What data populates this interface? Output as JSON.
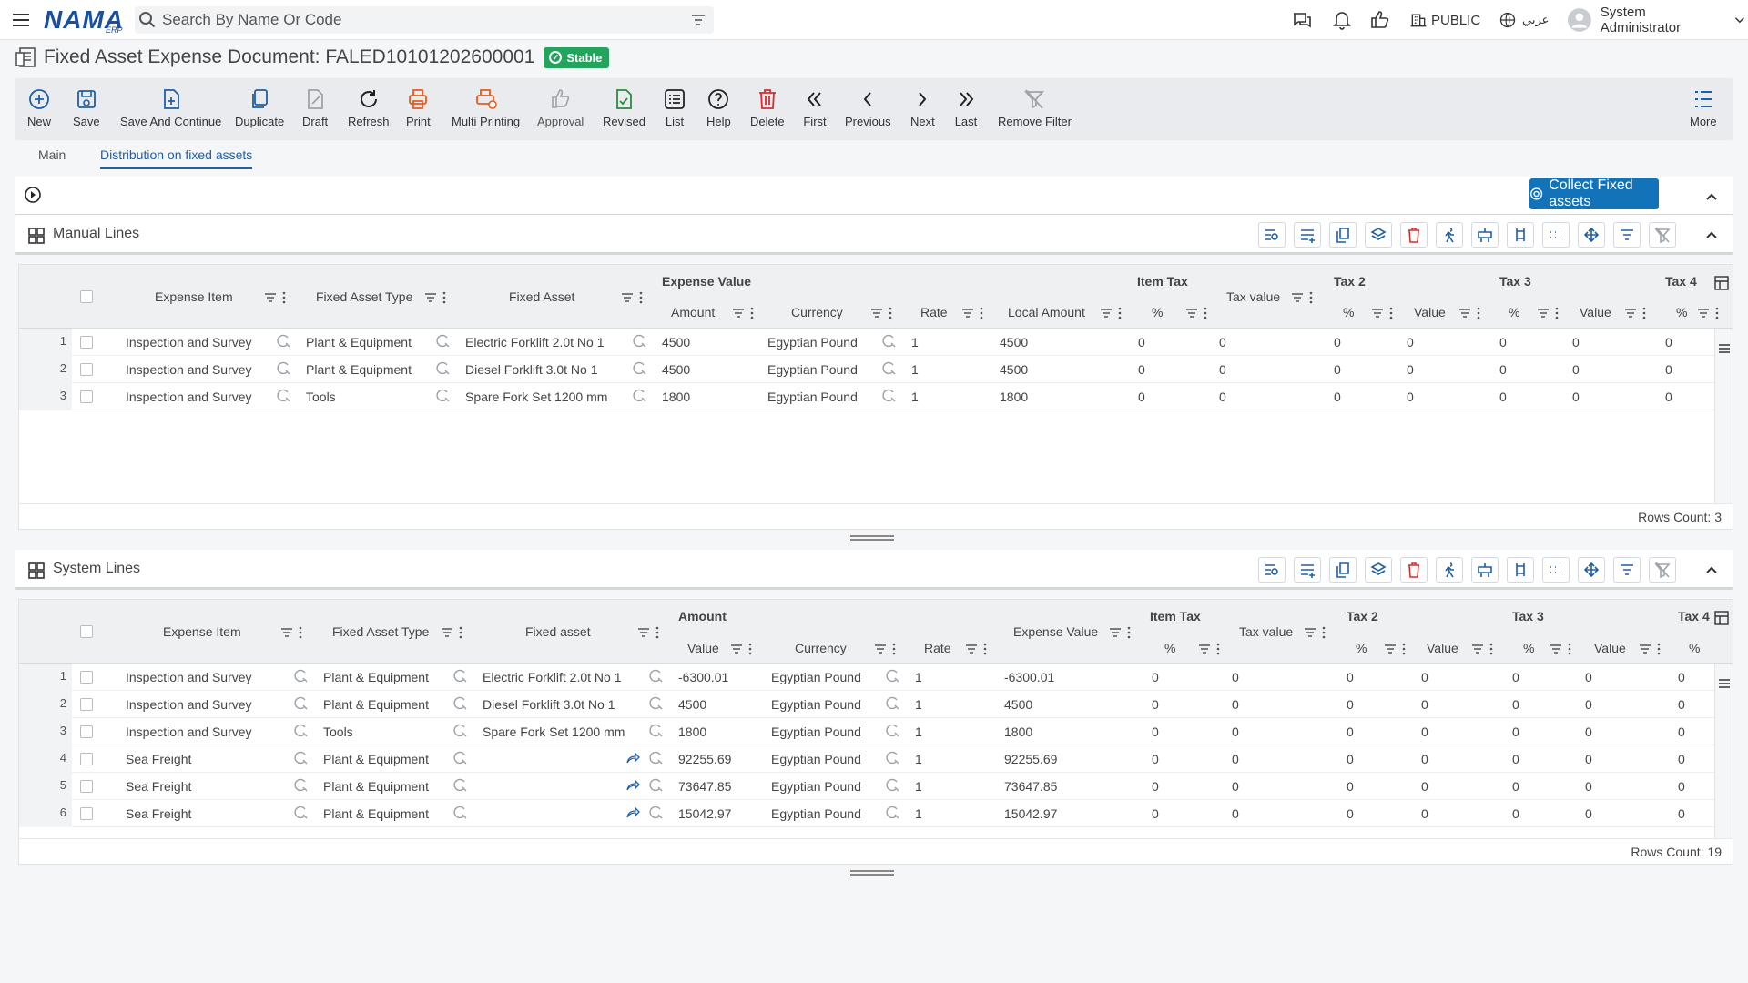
{
  "topbar": {
    "logo": "NAMA",
    "logo_sub": "ERP",
    "search_placeholder": "Search By Name Or Code",
    "company": "PUBLIC",
    "language": "عربي",
    "user": "System Administrator"
  },
  "page": {
    "title": "Fixed Asset Expense Document: FALED10101202600001",
    "status": "Stable"
  },
  "toolbar": {
    "new": "New",
    "save": "Save",
    "save_continue": "Save And Continue",
    "duplicate": "Duplicate",
    "draft": "Draft",
    "refresh": "Refresh",
    "print": "Print",
    "multi_printing": "Multi Printing",
    "approval": "Approval",
    "revised": "Revised",
    "list": "List",
    "help": "Help",
    "delete": "Delete",
    "first": "First",
    "previous": "Previous",
    "next": "Next",
    "last": "Last",
    "remove_filter": "Remove Filter",
    "more": "More"
  },
  "tabs": {
    "main": "Main",
    "distribution": "Distribution on fixed assets"
  },
  "collect_button": "Collect Fixed assets",
  "manual": {
    "title": "Manual Lines",
    "headers": {
      "expense_item": "Expense Item",
      "fixed_asset_type": "Fixed Asset Type",
      "fixed_asset": "Fixed Asset",
      "expense_value": "Expense Value",
      "amount": "Amount",
      "currency": "Currency",
      "rate": "Rate",
      "local_amount": "Local Amount",
      "item_tax": "Item Tax",
      "pct": "%",
      "tax_value": "Tax value",
      "tax2": "Tax 2",
      "value": "Value",
      "tax3": "Tax 3",
      "tax4": "Tax 4"
    },
    "rows": [
      {
        "n": "1",
        "expense_item": "Inspection and Survey",
        "type": "Plant & Equipment",
        "asset": "Electric Forklift 2.0t No 1",
        "amount": "4500",
        "currency": "Egyptian Pound",
        "rate": "1",
        "local": "4500",
        "it_pct": "0",
        "tax_value": "0",
        "t2_pct": "0",
        "t2_val": "0",
        "t3_pct": "0",
        "t3_val": "0",
        "t4_pct": "0"
      },
      {
        "n": "2",
        "expense_item": "Inspection and Survey",
        "type": "Plant & Equipment",
        "asset": "Diesel Forklift 3.0t No 1",
        "amount": "4500",
        "currency": "Egyptian Pound",
        "rate": "1",
        "local": "4500",
        "it_pct": "0",
        "tax_value": "0",
        "t2_pct": "0",
        "t2_val": "0",
        "t3_pct": "0",
        "t3_val": "0",
        "t4_pct": "0"
      },
      {
        "n": "3",
        "expense_item": "Inspection and Survey",
        "type": "Tools",
        "asset": "Spare Fork Set 1200 mm",
        "amount": "1800",
        "currency": "Egyptian Pound",
        "rate": "1",
        "local": "1800",
        "it_pct": "0",
        "tax_value": "0",
        "t2_pct": "0",
        "t2_val": "0",
        "t3_pct": "0",
        "t3_val": "0",
        "t4_pct": "0"
      }
    ],
    "rows_count": "Rows Count: 3"
  },
  "system": {
    "title": "System Lines",
    "headers": {
      "expense_item": "Expense Item",
      "fixed_asset_type": "Fixed Asset Type",
      "fixed_asset": "Fixed asset",
      "amount": "Amount",
      "value": "Value",
      "currency": "Currency",
      "rate": "Rate",
      "expense_value": "Expense Value",
      "item_tax": "Item Tax",
      "pct": "%",
      "tax_value": "Tax value",
      "tax2": "Tax 2",
      "tax3": "Tax 3",
      "tax4": "Tax 4"
    },
    "rows": [
      {
        "n": "1",
        "expense_item": "Inspection and Survey",
        "type": "Plant & Equipment",
        "asset": "Electric Forklift 2.0t No 1",
        "value": "-6300.01",
        "currency": "Egyptian Pound",
        "rate": "1",
        "expense_value": "-6300.01",
        "it_pct": "0",
        "tax_value": "0",
        "t2_pct": "0",
        "t2_val": "0",
        "t3_pct": "0",
        "t3_val": "0",
        "t4_pct": "0",
        "share": false
      },
      {
        "n": "2",
        "expense_item": "Inspection and Survey",
        "type": "Plant & Equipment",
        "asset": "Diesel Forklift 3.0t No 1",
        "value": "4500",
        "currency": "Egyptian Pound",
        "rate": "1",
        "expense_value": "4500",
        "it_pct": "0",
        "tax_value": "0",
        "t2_pct": "0",
        "t2_val": "0",
        "t3_pct": "0",
        "t3_val": "0",
        "t4_pct": "0",
        "share": false
      },
      {
        "n": "3",
        "expense_item": "Inspection and Survey",
        "type": "Tools",
        "asset": "Spare Fork Set 1200 mm",
        "value": "1800",
        "currency": "Egyptian Pound",
        "rate": "1",
        "expense_value": "1800",
        "it_pct": "0",
        "tax_value": "0",
        "t2_pct": "0",
        "t2_val": "0",
        "t3_pct": "0",
        "t3_val": "0",
        "t4_pct": "0",
        "share": false
      },
      {
        "n": "4",
        "expense_item": "Sea Freight",
        "type": "Plant & Equipment",
        "asset": "",
        "value": "92255.69",
        "currency": "Egyptian Pound",
        "rate": "1",
        "expense_value": "92255.69",
        "it_pct": "0",
        "tax_value": "0",
        "t2_pct": "0",
        "t2_val": "0",
        "t3_pct": "0",
        "t3_val": "0",
        "t4_pct": "0",
        "share": true
      },
      {
        "n": "5",
        "expense_item": "Sea Freight",
        "type": "Plant & Equipment",
        "asset": "",
        "value": "73647.85",
        "currency": "Egyptian Pound",
        "rate": "1",
        "expense_value": "73647.85",
        "it_pct": "0",
        "tax_value": "0",
        "t2_pct": "0",
        "t2_val": "0",
        "t3_pct": "0",
        "t3_val": "0",
        "t4_pct": "0",
        "share": true
      },
      {
        "n": "6",
        "expense_item": "Sea Freight",
        "type": "Plant & Equipment",
        "asset": "",
        "value": "15042.97",
        "currency": "Egyptian Pound",
        "rate": "1",
        "expense_value": "15042.97",
        "it_pct": "0",
        "tax_value": "0",
        "t2_pct": "0",
        "t2_val": "0",
        "t3_pct": "0",
        "t3_val": "0",
        "t4_pct": "0",
        "share": true
      }
    ],
    "rows_count": "Rows Count: 19"
  },
  "colors": {
    "primary": "#1f5fa5",
    "status": "#22a45d",
    "collect": "#1373b8",
    "danger": "#d32f2f",
    "print": "#e65c1a"
  }
}
